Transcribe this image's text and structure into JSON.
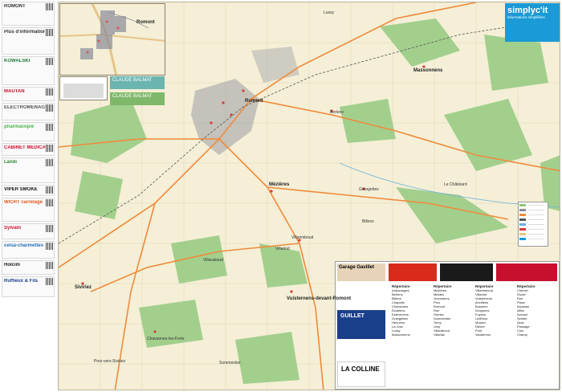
{
  "brand": {
    "name": "simplyc'it",
    "tagline": "informations simplifiées",
    "colors": {
      "brand": "#1a9ad6",
      "forest": "#8fc77a",
      "town": "#8a8c9a",
      "road": "#f08a3a",
      "paper": "#f4efd6"
    }
  },
  "ads_left": [
    {
      "text": "ROMONT",
      "color": "#ffffff"
    },
    {
      "text": "Plus d'informations",
      "color": "#ffffff"
    },
    {
      "text": "KOWALSKI",
      "color": "#1f7a3a"
    },
    {
      "text": "MAUTAN",
      "color": "#c8102e"
    },
    {
      "text": "ELECTROMÉNAGER SERVICES SA",
      "color": "#555555"
    },
    {
      "text": "pharmacopie",
      "color": "#4bb24b"
    },
    {
      "text": "CABINET MÉDICAL ROMONT",
      "color": "#c8102e"
    },
    {
      "text": "Landi",
      "color": "#2f8a32"
    },
    {
      "text": "VIPER SMOKE",
      "color": "#111111"
    },
    {
      "text": "WICHT carrelage",
      "color": "#e05a1a"
    },
    {
      "text": "Sylvani",
      "color": "#c8102e"
    },
    {
      "text": "celsa-charmettes",
      "color": "#2a6fb4"
    },
    {
      "text": "Holcim",
      "color": "#1a1a1a"
    },
    {
      "text": "Ruffieux & Fils",
      "color": "#1a3a8a"
    }
  ],
  "places": [
    {
      "name": "Romont",
      "big": true
    },
    {
      "name": "Romont",
      "big": true
    },
    {
      "name": "Mézières",
      "big": true
    },
    {
      "name": "Massonnens",
      "big": true
    },
    {
      "name": "Berlens",
      "big": false
    },
    {
      "name": "Grangettes",
      "big": false
    },
    {
      "name": "Villaraboud",
      "big": false
    },
    {
      "name": "Siviriez",
      "big": true
    },
    {
      "name": "Vuisternens-devant-Romont",
      "big": true
    },
    {
      "name": "Billens",
      "big": false
    },
    {
      "name": "Villarimboud",
      "big": false
    },
    {
      "name": "Chavannes-les-Forts",
      "big": false
    },
    {
      "name": "Prez-vers-Siviriez",
      "big": false
    },
    {
      "name": "Sommentier",
      "big": false
    },
    {
      "name": "Le Châtelard",
      "big": false
    },
    {
      "name": "Lussy",
      "big": false
    },
    {
      "name": "Villarlod",
      "big": false
    }
  ],
  "promos": [
    {
      "text": "CLAUDE BALMAT"
    },
    {
      "text": "CLAUDE BALMAT"
    }
  ],
  "index": {
    "ads": [
      "Garage Gavillet",
      "GUILLET",
      "LA COLLINE"
    ],
    "columns": [
      {
        "head": "Répertoire",
        "rows": [
          "Auboranges",
          "Berlens",
          "Billens",
          "Chapelle",
          "Chavannes",
          "Écublens",
          "Estévenens",
          "Grangettes",
          "Hennens",
          "La Joux",
          "Lussy",
          "Massonnens"
        ]
      },
      {
        "head": "Répertoire",
        "rows": [
          "Mézières",
          "Middes",
          "Orsonnens",
          "Prez",
          "Romont",
          "Rue",
          "Siviriez",
          "Sommentier",
          "Torny",
          "Ursy",
          "Villaraboud",
          "Villariaz"
        ]
      },
      {
        "head": "Répertoire",
        "rows": [
          "Villarimboud",
          "Villarlod",
          "Vuisternens",
          "Arruffens",
          "Bossens",
          "Drognens",
          "Fuyens",
          "Lieffrens",
          "Mossel",
          "Nierlet",
          "Pont",
          "Vauderens"
        ]
      },
      {
        "head": "Répertoire",
        "rows": [
          "Chemin",
          "Route",
          "Rue",
          "Place",
          "Impasse",
          "Allée",
          "Avenue",
          "Sentier",
          "Quai",
          "Passage",
          "Clos",
          "Champ"
        ]
      }
    ]
  }
}
